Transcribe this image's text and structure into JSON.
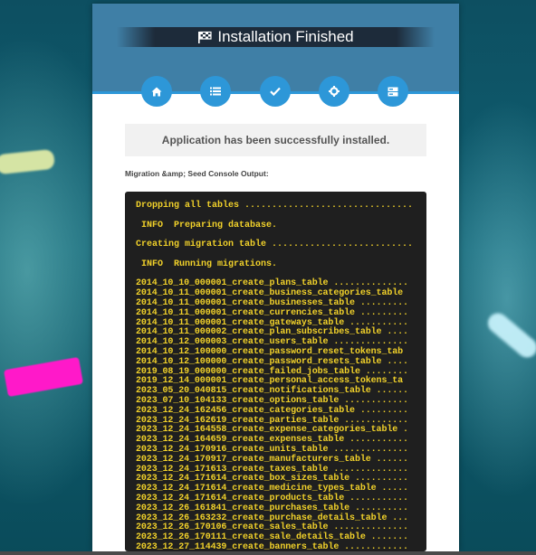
{
  "header": {
    "title": "Installation Finished",
    "steps": [
      {
        "icon": "home-icon"
      },
      {
        "icon": "list-icon"
      },
      {
        "icon": "check-icon"
      },
      {
        "icon": "gear-icon"
      },
      {
        "icon": "server-icon"
      }
    ]
  },
  "main": {
    "success_message": "Application has been successfully installed.",
    "output_label": "Migration &amp; Seed Console Output:",
    "console_lines": [
      "Dropping all tables ...............................",
      "",
      " INFO  Preparing database.",
      "",
      "Creating migration table ..........................",
      "",
      " INFO  Running migrations.",
      ""
    ],
    "migrations": [
      "2014_10_10_000001_create_plans_table ..............",
      "2014_10_11_000001_create_business_categories_table",
      "2014_10_11_000001_create_businesses_table .........",
      "2014_10_11_000001_create_currencies_table .........",
      "2014_10_11_000001_create_gateways_table ...........",
      "2014_10_11_000002_create_plan_subscribes_table ....",
      "2014_10_12_000003_create_users_table ..............",
      "2014_10_12_100000_create_password_reset_tokens_tab",
      "2014_10_12_100000_create_password_resets_table ....",
      "2019_08_19_000000_create_failed_jobs_table ........",
      "2019_12_14_000001_create_personal_access_tokens_ta",
      "2023_05_20_040815_create_notifications_table ......",
      "2023_07_10_104133_create_options_table ............",
      "2023_12_24_162456_create_categories_table .........",
      "2023_12_24_162619_create_parties_table ............",
      "2023_12_24_164558_create_expense_categories_table .",
      "2023_12_24_164659_create_expenses_table ...........",
      "2023_12_24_170916_create_units_table ..............",
      "2023_12_24_170917_create_manufacturers_table ......",
      "2023_12_24_171613_create_taxes_table ..............",
      "2023_12_24_171614_create_box_sizes_table ..........",
      "2023_12_24_171614_create_medicine_types_table .....",
      "2023_12_24_171614_create_products_table ...........",
      "2023_12_26_161841_create_purchases_table ..........",
      "2023_12_26_163232_create_purchase_details_table ...",
      "2023_12_26_170106_create_sales_table ..............",
      "2023_12_26_170111_create_sale_details_table .......",
      "2023_12_27_114439_create_banners_table ............"
    ]
  }
}
